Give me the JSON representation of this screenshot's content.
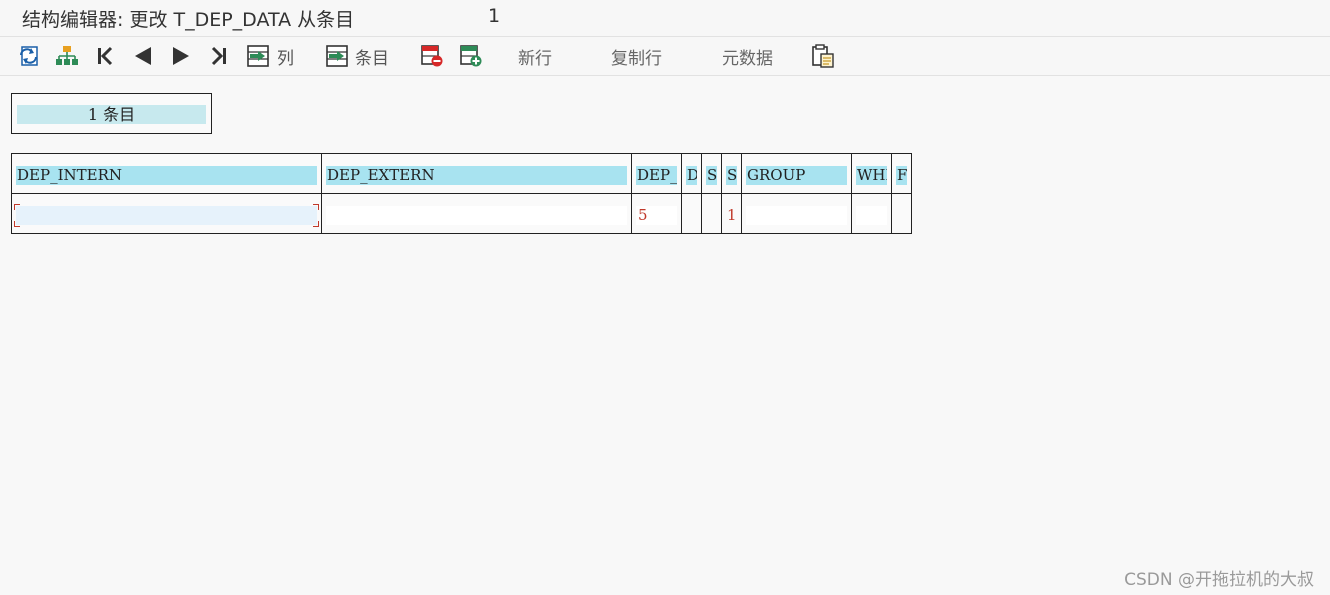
{
  "title": {
    "text": "结构编辑器: 更改 T_DEP_DATA 从条目",
    "count": "1"
  },
  "toolbar": {
    "columns_label": "列",
    "entries_label": "条目",
    "new_row": "新行",
    "copy_row": "复制行",
    "metadata": "元数据"
  },
  "entry_indicator": "1 条目",
  "table": {
    "headers": [
      "DEP_INTERN",
      "DEP_EXTERN",
      "DEP_",
      "D",
      "S",
      "S",
      "GROUP",
      "WHR",
      "F"
    ],
    "row": [
      "",
      "",
      "5",
      "",
      "",
      "1",
      "",
      "",
      ""
    ]
  },
  "watermark": "CSDN @开拖拉机的大叔",
  "colors": {
    "header_highlight": "#a8e3f0",
    "entry_highlight": "#c7e9ee",
    "value_text": "#c0392b",
    "icon_green": "#2e8b57",
    "icon_red": "#d62828",
    "icon_blue": "#1a5fa8"
  }
}
